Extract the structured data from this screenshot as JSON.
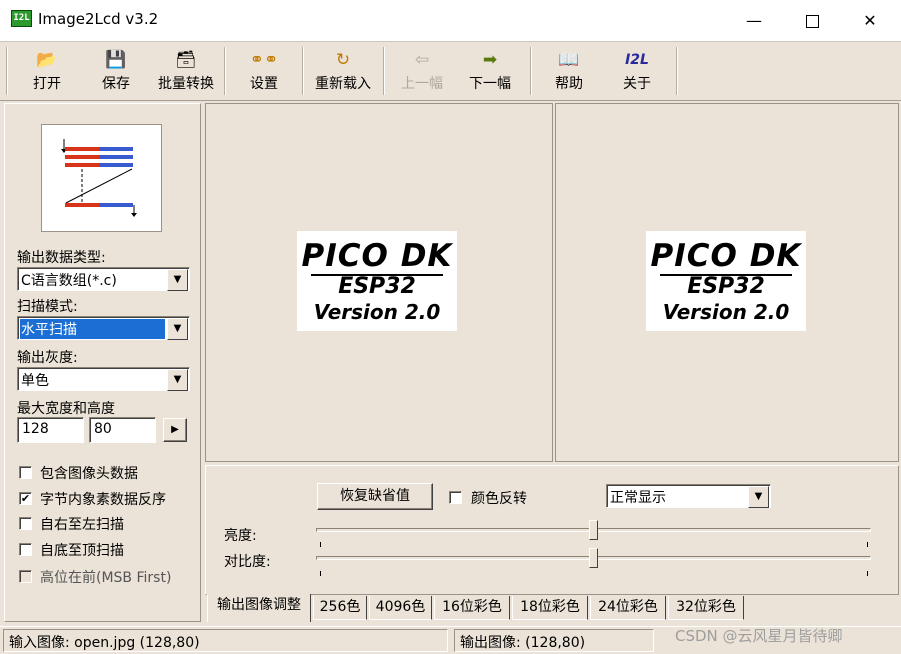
{
  "window": {
    "title": "Image2Lcd v3.2",
    "icon_text": "I2L"
  },
  "toolbar": {
    "items": [
      {
        "label": "打开",
        "icon": "open-folder-icon"
      },
      {
        "label": "保存",
        "icon": "floppy-icon"
      },
      {
        "label": "批量转换",
        "icon": "batch-icon"
      },
      {
        "label": "设置",
        "icon": "glasses-icon"
      },
      {
        "label": "重新载入",
        "icon": "reload-icon"
      },
      {
        "label": "上一幅",
        "icon": "prev-icon",
        "disabled": true
      },
      {
        "label": "下一幅",
        "icon": "next-icon"
      },
      {
        "label": "帮助",
        "icon": "help-book-icon"
      },
      {
        "label": "关于",
        "icon": "i2l-logo-icon",
        "icon_text": "I2L"
      }
    ]
  },
  "left": {
    "output_type_label": "输出数据类型:",
    "output_type_value": "C语言数组(*.c)",
    "scan_mode_label": "扫描模式:",
    "scan_mode_value": "水平扫描",
    "gray_label": "输出灰度:",
    "gray_value": "单色",
    "size_label": "最大宽度和高度",
    "width_value": "128",
    "height_value": "80",
    "arrow_button": "▶",
    "checkboxes": [
      {
        "label": "包含图像头数据",
        "checked": false
      },
      {
        "label": "字节内象素数据反序",
        "checked": true
      },
      {
        "label": "自右至左扫描",
        "checked": false
      },
      {
        "label": "自底至顶扫描",
        "checked": false
      },
      {
        "label": "高位在前(MSB First)",
        "checked": false,
        "disabled": true
      }
    ]
  },
  "preview": {
    "line1": "PICO DK",
    "line2": "ESP32",
    "line3": "Version 2.0"
  },
  "adjust": {
    "restore_button": "恢复缺省值",
    "invert_label": "颜色反转",
    "invert_checked": false,
    "display_mode": "正常显示",
    "brightness_label": "亮度:",
    "brightness_level": 0.5,
    "contrast_label": "对比度:",
    "contrast_level": 0.5
  },
  "tabs": [
    "输出图像调整",
    "256色",
    "4096色",
    "16位彩色",
    "18位彩色",
    "24位彩色",
    "32位彩色"
  ],
  "status": {
    "input": "输入图像: open.jpg (128,80)",
    "output": "输出图像: (128,80)"
  },
  "watermark": "CSDN @云风星月皆待卿",
  "colors": {
    "selection": "#1b6fd4",
    "face": "#ece3d8"
  }
}
